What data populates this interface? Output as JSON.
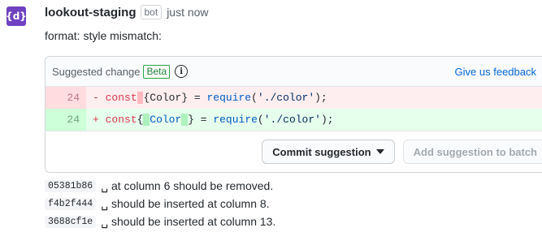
{
  "comment": {
    "avatar_text": "{d}",
    "author": "lookout-staging",
    "bot_label": "bot",
    "time": "just now",
    "message": "format: style mismatch:"
  },
  "suggestion": {
    "title": "Suggested change",
    "beta_label": "Beta",
    "info_icon": "i",
    "feedback_link": "Give us feedback",
    "deleted_line": {
      "number": "24",
      "sign": "-",
      "parts": [
        "const",
        " ",
        "{",
        "Color} = ",
        "require",
        "(",
        "'./color'",
        ");"
      ]
    },
    "added_line": {
      "number": "24",
      "sign": "+",
      "parts": [
        "const",
        "{",
        " ",
        "Color",
        " ",
        "} = ",
        "require",
        "(",
        "'./color'",
        ");"
      ]
    },
    "commit_button": "Commit suggestion",
    "batch_button": "Add suggestion to batch"
  },
  "notes": [
    {
      "hash": "05381b86",
      "text": "␣ at column 6 should be removed."
    },
    {
      "hash": "f4b2f444",
      "text": "␣ should be inserted at column 8."
    },
    {
      "hash": "3688cf1e",
      "text": "␣ should be inserted at column 13."
    }
  ],
  "colors": {
    "avatar_bg": "#6f42c1",
    "link": "#0366d6",
    "deleted_bg": "#ffeef0",
    "added_bg": "#e6ffed",
    "beta_green": "#28a745"
  }
}
